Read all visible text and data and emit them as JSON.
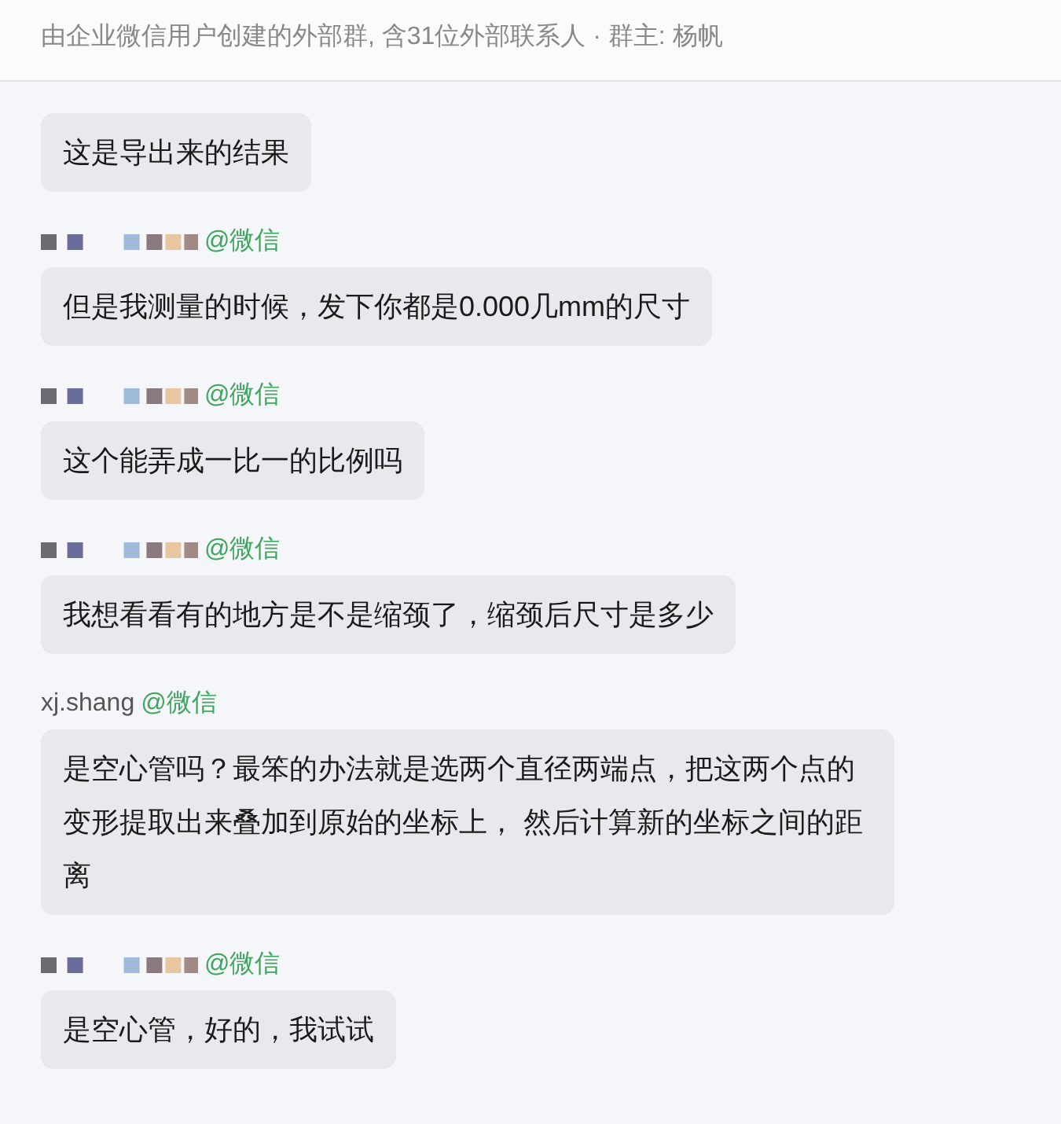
{
  "header": {
    "subtitle": "由企业微信用户创建的外部群, 含31位外部联系人 · 群主: 杨帆"
  },
  "messages": [
    {
      "text": "这是导出来的结果"
    },
    {
      "sender": {
        "kind": "redacted",
        "tag": "@微信"
      },
      "text": "但是我测量的时候，发下你都是0.000几mm的尺寸"
    },
    {
      "sender": {
        "kind": "redacted",
        "tag": "@微信"
      },
      "text": "这个能弄成一比一的比例吗"
    },
    {
      "sender": {
        "kind": "redacted",
        "tag": "@微信"
      },
      "text": "我想看看有的地方是不是缩颈了，缩颈后尺寸是多少"
    },
    {
      "sender": {
        "kind": "named",
        "name": "xj.shang",
        "tag": "@微信"
      },
      "text": "是空心管吗？最笨的办法就是选两个直径两端点，把这两个点的变形提取出来叠加到原始的坐标上， 然后计算新的坐标之间的距离"
    },
    {
      "sender": {
        "kind": "redacted",
        "tag": "@微信"
      },
      "text": "是空心管，好的，我试试"
    }
  ]
}
